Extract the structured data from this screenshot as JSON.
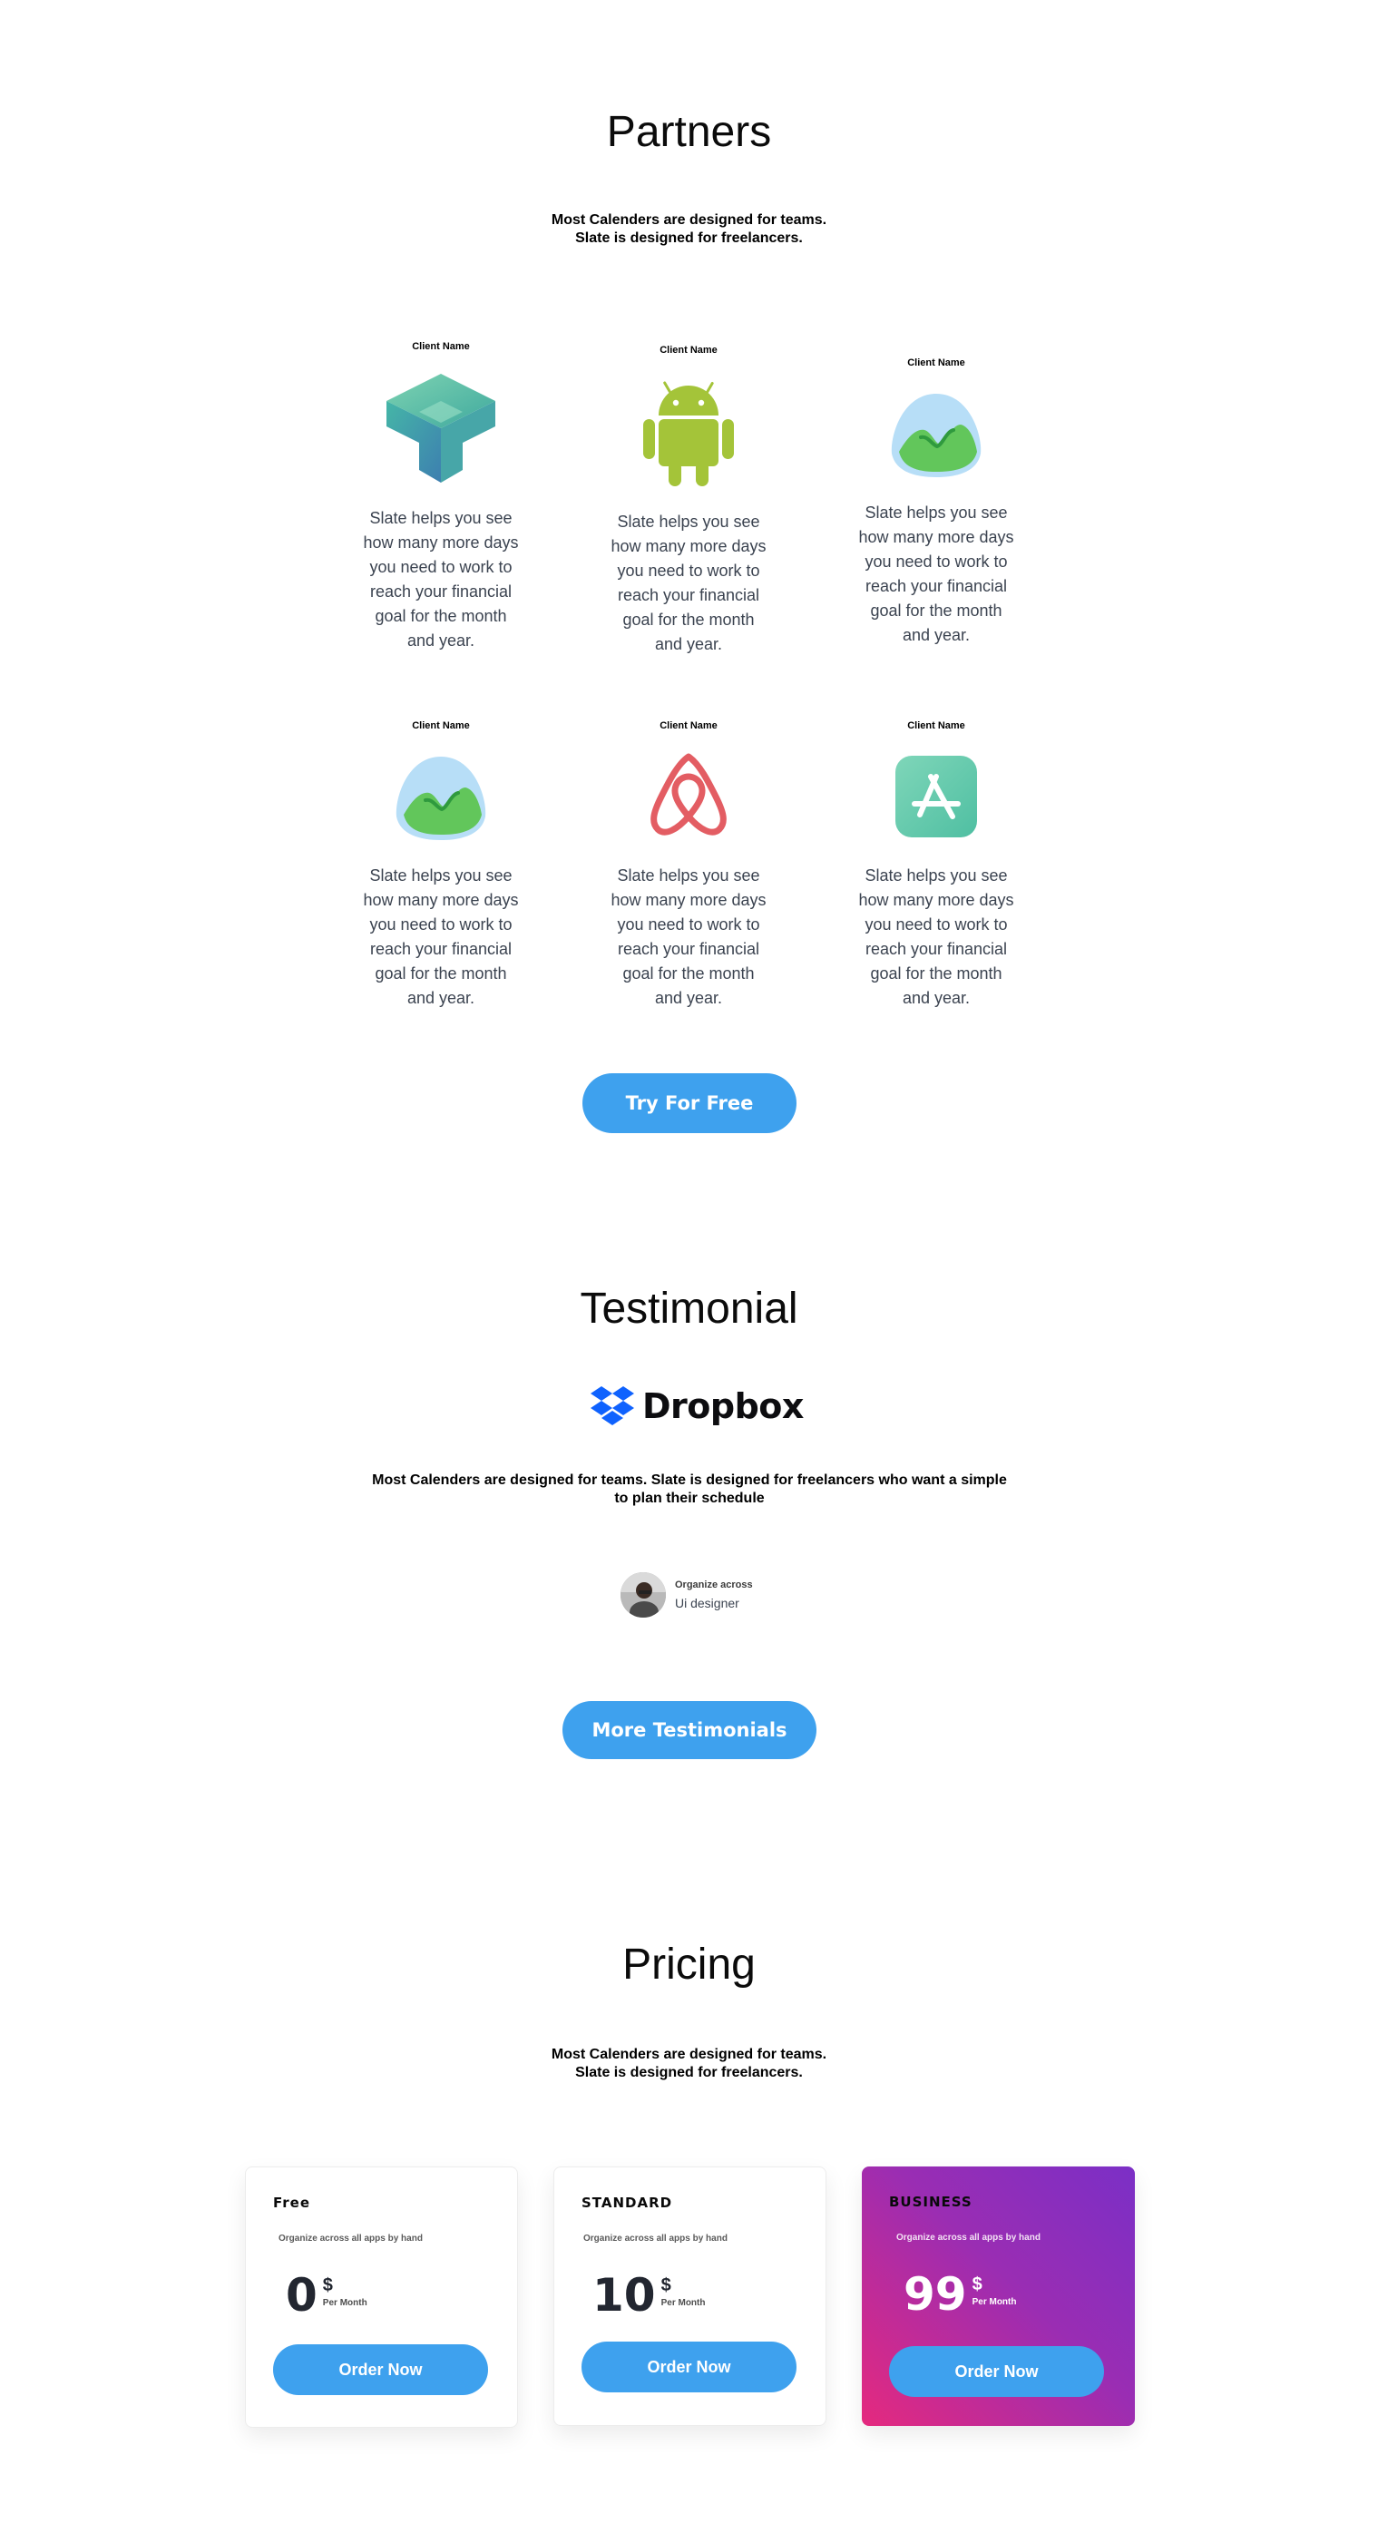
{
  "partners": {
    "title": "Partners",
    "subtitle_line1": "Most Calenders are designed for teams.",
    "subtitle_line2": "Slate is designed for freelancers.",
    "items": [
      {
        "name": "Client Name",
        "logo": "cube-icon",
        "description": "Slate helps you see how many more days you need to work to reach your financial goal for the month and year."
      },
      {
        "name": "Client Name",
        "logo": "android-icon",
        "description": "Slate helps you see how many more days you need to work to reach your financial goal for the month and year."
      },
      {
        "name": "Client Name",
        "logo": "basecamp-icon",
        "description": "Slate helps you see how many more days you need to work to reach your financial goal for the month and year."
      },
      {
        "name": "Client Name",
        "logo": "basecamp-icon",
        "description": "Slate helps you see how many more days you need to work to reach your financial goal for the month and year."
      },
      {
        "name": "Client Name",
        "logo": "airbnb-icon",
        "description": "Slate helps you see how many more days you need to work to reach your financial goal for the month and year."
      },
      {
        "name": "Client Name",
        "logo": "app-store-icon",
        "description": "Slate helps you see how many more days you need to work to reach your financial goal for the month and year."
      }
    ],
    "cta": "Try For Free"
  },
  "testimonial": {
    "title": "Testimonial",
    "brand": "Dropbox",
    "quote_line1": "Most Calenders are designed for teams. Slate is designed for freelancers who want a simple",
    "quote_line2": "to plan their schedule",
    "author_name": "Organize across",
    "author_role": "Ui designer",
    "cta": "More Testimonials"
  },
  "pricing": {
    "title": "Pricing",
    "subtitle_line1": "Most Calenders are designed for teams.",
    "subtitle_line2": "Slate is designed for freelancers.",
    "plans": [
      {
        "name": "Free",
        "description": "Organize across all apps by hand",
        "price": "0",
        "currency": "$",
        "period": "Per Month",
        "button": "Order Now"
      },
      {
        "name": "STANDARD",
        "description": "Organize across all apps by hand",
        "price": "10",
        "currency": "$",
        "period": "Per Month",
        "button": "Order Now"
      },
      {
        "name": "BUSINESS",
        "description": "Organize across all apps by hand",
        "price": "99",
        "currency": "$",
        "period": "Per Month",
        "button": "Order Now"
      }
    ]
  },
  "colors": {
    "accent": "#3ea1ee",
    "business_gradient_start": "#7b2fc6",
    "business_gradient_end": "#e5297e"
  }
}
